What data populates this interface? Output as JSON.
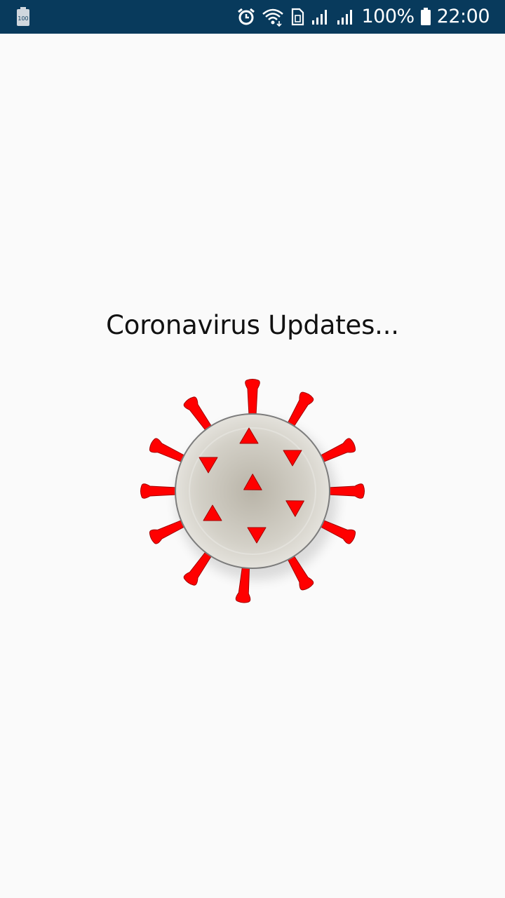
{
  "status_bar": {
    "left_icon": "battery-100-notification-icon",
    "left_badge": "100",
    "icons": [
      "alarm-icon",
      "wifi-icon",
      "sim-icon",
      "signal-icon",
      "signal-icon",
      "battery-icon"
    ],
    "battery_percent": "100%",
    "time": "22:00",
    "background_color": "#083a5c"
  },
  "splash": {
    "title": "Coronavirus Updates...",
    "logo": "coronavirus-icon",
    "accent_color": "#ff0000",
    "background_color": "#fafafa"
  }
}
